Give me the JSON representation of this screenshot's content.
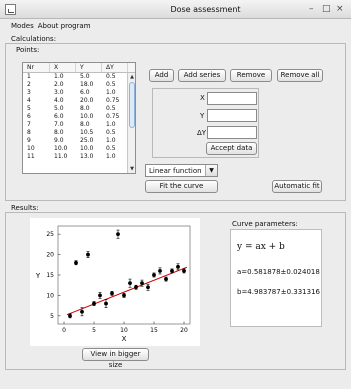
{
  "window": {
    "title": "Dose assessment"
  },
  "menu": {
    "items": [
      "Modes",
      "About program"
    ]
  },
  "calculations": {
    "label": "Calculations:",
    "points_label": "Points:",
    "table": {
      "headers": [
        "Nr",
        "X",
        "Y",
        "ΔY"
      ],
      "rows": [
        [
          "1",
          "1.0",
          "5.0",
          "0.5"
        ],
        [
          "2",
          "2.0",
          "18.0",
          "0.5"
        ],
        [
          "3",
          "3.0",
          "6.0",
          "1.0"
        ],
        [
          "4",
          "4.0",
          "20.0",
          "0.75"
        ],
        [
          "5",
          "5.0",
          "8.0",
          "0.5"
        ],
        [
          "6",
          "6.0",
          "10.0",
          "0.75"
        ],
        [
          "7",
          "7.0",
          "8.0",
          "1.0"
        ],
        [
          "8",
          "8.0",
          "10.5",
          "0.5"
        ],
        [
          "9",
          "9.0",
          "25.0",
          "1.0"
        ],
        [
          "10",
          "10.0",
          "10.0",
          "0.5"
        ],
        [
          "11",
          "11.0",
          "13.0",
          "1.0"
        ]
      ]
    },
    "buttons": {
      "add": "Add",
      "add_series": "Add series",
      "remove": "Remove",
      "remove_all": "Remove all",
      "accept": "Accept data",
      "fit": "Fit the curve",
      "automatic_fit": "Automatic fit"
    },
    "fields": {
      "x_label": "X",
      "y_label": "Y",
      "dy_label": "ΔY",
      "x_value": "",
      "y_value": "",
      "dy_value": ""
    },
    "function_select": {
      "selected": "Linear function"
    }
  },
  "results": {
    "label": "Results:",
    "curve_params_label": "Curve parameters:",
    "equation": "y = ax + b",
    "a": "a=0.581878±0.024018",
    "b": "b=4.983787±0.331316",
    "view_button": "View in bigger size"
  },
  "chart_data": {
    "type": "scatter",
    "xlabel": "X",
    "ylabel": "Y",
    "xlim": [
      -1,
      21
    ],
    "ylim": [
      3,
      27
    ],
    "xticks": [
      0,
      5,
      10,
      15,
      20
    ],
    "yticks": [
      5,
      10,
      15,
      20,
      25
    ],
    "points": [
      {
        "x": 1,
        "y": 5,
        "dy": 0.5
      },
      {
        "x": 2,
        "y": 18,
        "dy": 0.5
      },
      {
        "x": 3,
        "y": 6,
        "dy": 1.0
      },
      {
        "x": 4,
        "y": 20,
        "dy": 0.75
      },
      {
        "x": 5,
        "y": 8,
        "dy": 0.5
      },
      {
        "x": 6,
        "y": 10,
        "dy": 0.75
      },
      {
        "x": 7,
        "y": 8,
        "dy": 1.0
      },
      {
        "x": 8,
        "y": 10.5,
        "dy": 0.5
      },
      {
        "x": 9,
        "y": 25,
        "dy": 1.0
      },
      {
        "x": 10,
        "y": 10,
        "dy": 0.5
      },
      {
        "x": 11,
        "y": 13,
        "dy": 1.0
      },
      {
        "x": 12,
        "y": 12,
        "dy": 0.5
      },
      {
        "x": 13,
        "y": 13,
        "dy": 0.75
      },
      {
        "x": 14,
        "y": 12,
        "dy": 0.75
      },
      {
        "x": 15,
        "y": 15,
        "dy": 0.5
      },
      {
        "x": 16,
        "y": 16,
        "dy": 0.75
      },
      {
        "x": 17,
        "y": 14,
        "dy": 0.5
      },
      {
        "x": 18,
        "y": 16,
        "dy": 0.5
      },
      {
        "x": 19,
        "y": 17,
        "dy": 0.75
      },
      {
        "x": 20,
        "y": 16,
        "dy": 0.5
      }
    ],
    "fit": {
      "a": 0.581878,
      "b": 4.983787
    },
    "point_color": "#000000",
    "fit_color": "#cc0000"
  }
}
